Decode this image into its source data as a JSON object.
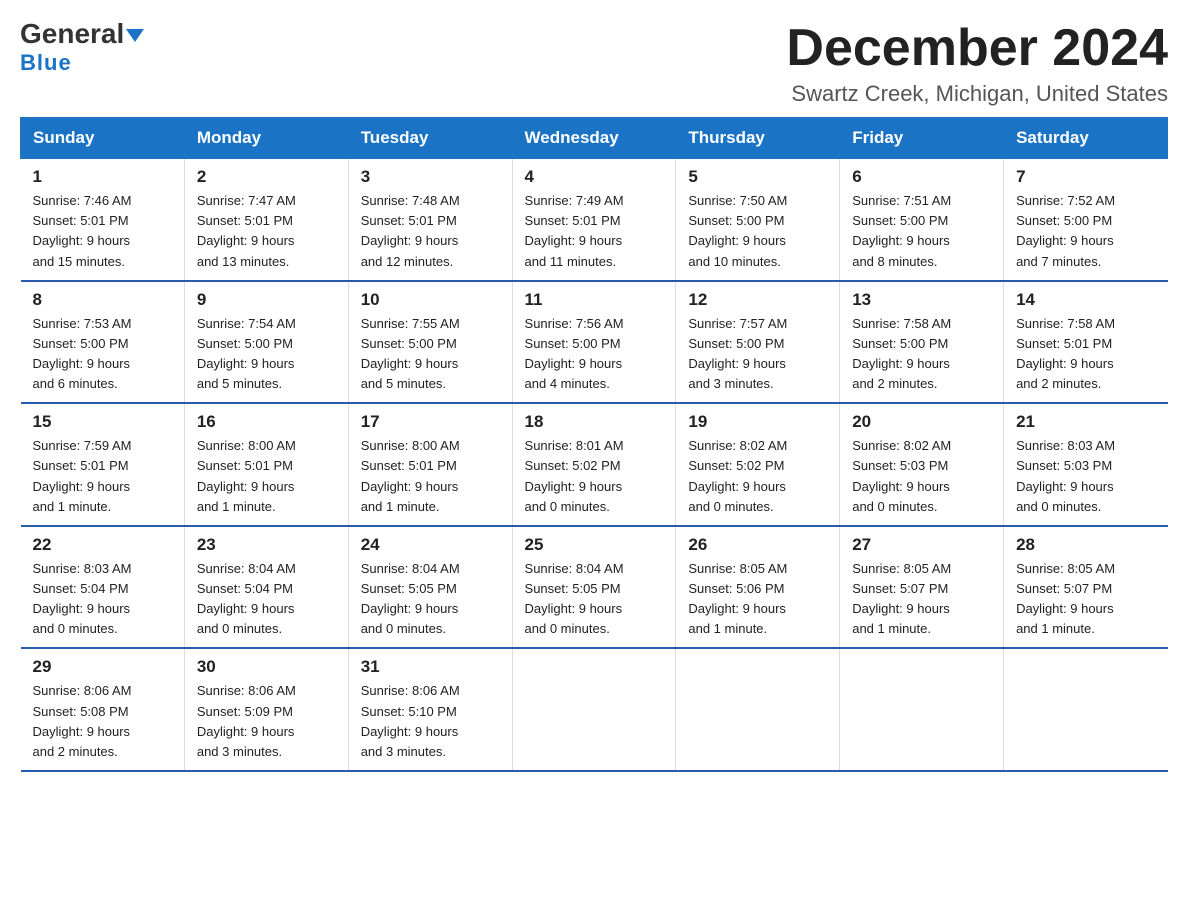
{
  "header": {
    "logo_line1": "General",
    "logo_line2": "Blue",
    "month_title": "December 2024",
    "location": "Swartz Creek, Michigan, United States"
  },
  "weekdays": [
    "Sunday",
    "Monday",
    "Tuesday",
    "Wednesday",
    "Thursday",
    "Friday",
    "Saturday"
  ],
  "weeks": [
    [
      {
        "day": "1",
        "info": "Sunrise: 7:46 AM\nSunset: 5:01 PM\nDaylight: 9 hours\nand 15 minutes."
      },
      {
        "day": "2",
        "info": "Sunrise: 7:47 AM\nSunset: 5:01 PM\nDaylight: 9 hours\nand 13 minutes."
      },
      {
        "day": "3",
        "info": "Sunrise: 7:48 AM\nSunset: 5:01 PM\nDaylight: 9 hours\nand 12 minutes."
      },
      {
        "day": "4",
        "info": "Sunrise: 7:49 AM\nSunset: 5:01 PM\nDaylight: 9 hours\nand 11 minutes."
      },
      {
        "day": "5",
        "info": "Sunrise: 7:50 AM\nSunset: 5:00 PM\nDaylight: 9 hours\nand 10 minutes."
      },
      {
        "day": "6",
        "info": "Sunrise: 7:51 AM\nSunset: 5:00 PM\nDaylight: 9 hours\nand 8 minutes."
      },
      {
        "day": "7",
        "info": "Sunrise: 7:52 AM\nSunset: 5:00 PM\nDaylight: 9 hours\nand 7 minutes."
      }
    ],
    [
      {
        "day": "8",
        "info": "Sunrise: 7:53 AM\nSunset: 5:00 PM\nDaylight: 9 hours\nand 6 minutes."
      },
      {
        "day": "9",
        "info": "Sunrise: 7:54 AM\nSunset: 5:00 PM\nDaylight: 9 hours\nand 5 minutes."
      },
      {
        "day": "10",
        "info": "Sunrise: 7:55 AM\nSunset: 5:00 PM\nDaylight: 9 hours\nand 5 minutes."
      },
      {
        "day": "11",
        "info": "Sunrise: 7:56 AM\nSunset: 5:00 PM\nDaylight: 9 hours\nand 4 minutes."
      },
      {
        "day": "12",
        "info": "Sunrise: 7:57 AM\nSunset: 5:00 PM\nDaylight: 9 hours\nand 3 minutes."
      },
      {
        "day": "13",
        "info": "Sunrise: 7:58 AM\nSunset: 5:00 PM\nDaylight: 9 hours\nand 2 minutes."
      },
      {
        "day": "14",
        "info": "Sunrise: 7:58 AM\nSunset: 5:01 PM\nDaylight: 9 hours\nand 2 minutes."
      }
    ],
    [
      {
        "day": "15",
        "info": "Sunrise: 7:59 AM\nSunset: 5:01 PM\nDaylight: 9 hours\nand 1 minute."
      },
      {
        "day": "16",
        "info": "Sunrise: 8:00 AM\nSunset: 5:01 PM\nDaylight: 9 hours\nand 1 minute."
      },
      {
        "day": "17",
        "info": "Sunrise: 8:00 AM\nSunset: 5:01 PM\nDaylight: 9 hours\nand 1 minute."
      },
      {
        "day": "18",
        "info": "Sunrise: 8:01 AM\nSunset: 5:02 PM\nDaylight: 9 hours\nand 0 minutes."
      },
      {
        "day": "19",
        "info": "Sunrise: 8:02 AM\nSunset: 5:02 PM\nDaylight: 9 hours\nand 0 minutes."
      },
      {
        "day": "20",
        "info": "Sunrise: 8:02 AM\nSunset: 5:03 PM\nDaylight: 9 hours\nand 0 minutes."
      },
      {
        "day": "21",
        "info": "Sunrise: 8:03 AM\nSunset: 5:03 PM\nDaylight: 9 hours\nand 0 minutes."
      }
    ],
    [
      {
        "day": "22",
        "info": "Sunrise: 8:03 AM\nSunset: 5:04 PM\nDaylight: 9 hours\nand 0 minutes."
      },
      {
        "day": "23",
        "info": "Sunrise: 8:04 AM\nSunset: 5:04 PM\nDaylight: 9 hours\nand 0 minutes."
      },
      {
        "day": "24",
        "info": "Sunrise: 8:04 AM\nSunset: 5:05 PM\nDaylight: 9 hours\nand 0 minutes."
      },
      {
        "day": "25",
        "info": "Sunrise: 8:04 AM\nSunset: 5:05 PM\nDaylight: 9 hours\nand 0 minutes."
      },
      {
        "day": "26",
        "info": "Sunrise: 8:05 AM\nSunset: 5:06 PM\nDaylight: 9 hours\nand 1 minute."
      },
      {
        "day": "27",
        "info": "Sunrise: 8:05 AM\nSunset: 5:07 PM\nDaylight: 9 hours\nand 1 minute."
      },
      {
        "day": "28",
        "info": "Sunrise: 8:05 AM\nSunset: 5:07 PM\nDaylight: 9 hours\nand 1 minute."
      }
    ],
    [
      {
        "day": "29",
        "info": "Sunrise: 8:06 AM\nSunset: 5:08 PM\nDaylight: 9 hours\nand 2 minutes."
      },
      {
        "day": "30",
        "info": "Sunrise: 8:06 AM\nSunset: 5:09 PM\nDaylight: 9 hours\nand 3 minutes."
      },
      {
        "day": "31",
        "info": "Sunrise: 8:06 AM\nSunset: 5:10 PM\nDaylight: 9 hours\nand 3 minutes."
      },
      {
        "day": "",
        "info": ""
      },
      {
        "day": "",
        "info": ""
      },
      {
        "day": "",
        "info": ""
      },
      {
        "day": "",
        "info": ""
      }
    ]
  ]
}
